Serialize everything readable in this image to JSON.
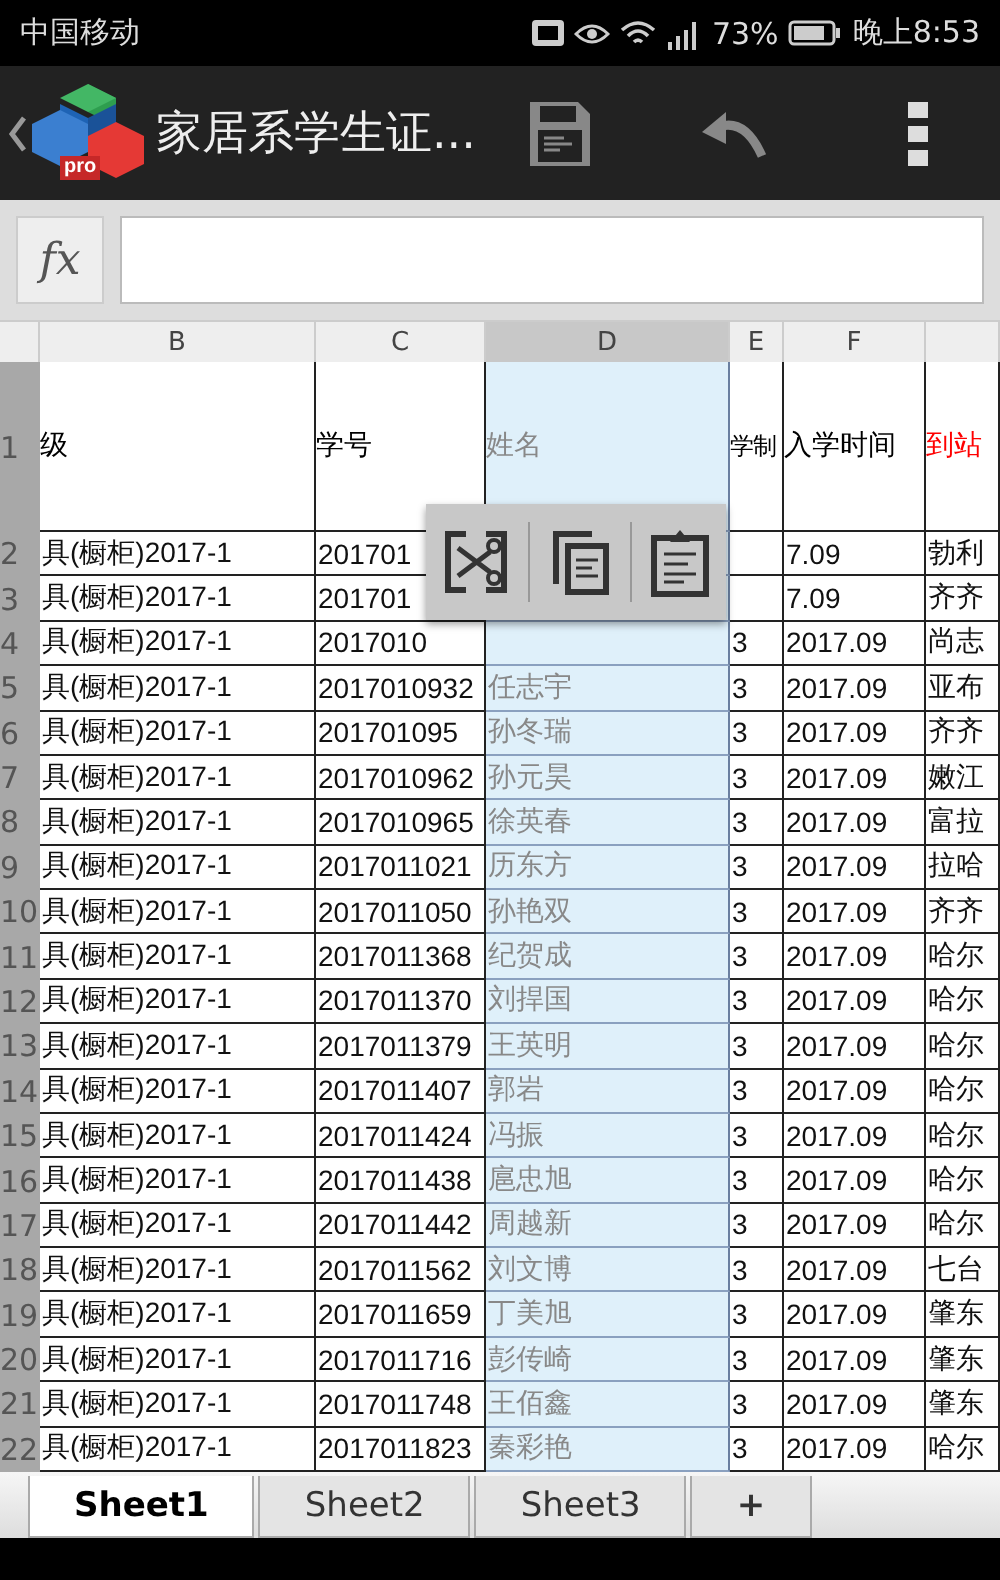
{
  "status_bar": {
    "carrier": "中国移动",
    "battery": "73%",
    "time": "晚上8:53"
  },
  "app_bar": {
    "logo_badge": "pro",
    "title": "家居系学生证..."
  },
  "formula_bar": {
    "label": "fx"
  },
  "sheet": {
    "columns": [
      {
        "label": "B",
        "selected": false
      },
      {
        "label": "C",
        "selected": false
      },
      {
        "label": "D",
        "selected": true
      },
      {
        "label": "E",
        "selected": false
      },
      {
        "label": "F",
        "selected": false
      }
    ],
    "header_row": {
      "number": "1",
      "cells": [
        {
          "text": "级",
          "color": "#000000"
        },
        {
          "text": "学号",
          "color": "#000000"
        },
        {
          "text": "姓名",
          "color": "#888888"
        },
        {
          "text": "学制",
          "color": "#000000"
        },
        {
          "text": "入学时间",
          "color": "#000000"
        },
        {
          "text": "到站",
          "color": "#ff0000"
        }
      ]
    },
    "rows": [
      {
        "number": "2",
        "cells": [
          "具(橱柜)2017-1",
          "201701",
          null,
          null,
          "7.09",
          "勃利"
        ]
      },
      {
        "number": "3",
        "cells": [
          "具(橱柜)2017-1",
          "201701",
          null,
          null,
          "7.09",
          "齐齐"
        ]
      },
      {
        "number": "4",
        "cells": [
          "具(橱柜)2017-1",
          "2017010",
          null,
          "3",
          "2017.09",
          "尚志"
        ]
      },
      {
        "number": "5",
        "cells": [
          "具(橱柜)2017-1",
          "2017010932",
          "任志宇",
          "3",
          "2017.09",
          "亚布"
        ]
      },
      {
        "number": "6",
        "cells": [
          "具(橱柜)2017-1",
          "201701095",
          "孙冬瑞",
          "3",
          "2017.09",
          "齐齐"
        ]
      },
      {
        "number": "7",
        "cells": [
          "具(橱柜)2017-1",
          "2017010962",
          "孙元昊",
          "3",
          "2017.09",
          "嫩江"
        ]
      },
      {
        "number": "8",
        "cells": [
          "具(橱柜)2017-1",
          "2017010965",
          "徐英春",
          "3",
          "2017.09",
          "富拉"
        ]
      },
      {
        "number": "9",
        "cells": [
          "具(橱柜)2017-1",
          "2017011021",
          "历东方",
          "3",
          "2017.09",
          "拉哈"
        ]
      },
      {
        "number": "10",
        "cells": [
          "具(橱柜)2017-1",
          "2017011050",
          "孙艳双",
          "3",
          "2017.09",
          "齐齐"
        ]
      },
      {
        "number": "11",
        "cells": [
          "具(橱柜)2017-1",
          "2017011368",
          "纪贺成",
          "3",
          "2017.09",
          "哈尔"
        ]
      },
      {
        "number": "12",
        "cells": [
          "具(橱柜)2017-1",
          "2017011370",
          "刘捍国",
          "3",
          "2017.09",
          "哈尔"
        ]
      },
      {
        "number": "13",
        "cells": [
          "具(橱柜)2017-1",
          "2017011379",
          "王英明",
          "3",
          "2017.09",
          "哈尔"
        ]
      },
      {
        "number": "14",
        "cells": [
          "具(橱柜)2017-1",
          "2017011407",
          "郭岩",
          "3",
          "2017.09",
          "哈尔"
        ]
      },
      {
        "number": "15",
        "cells": [
          "具(橱柜)2017-1",
          "2017011424",
          "冯振",
          "3",
          "2017.09",
          "哈尔"
        ]
      },
      {
        "number": "16",
        "cells": [
          "具(橱柜)2017-1",
          "2017011438",
          "扈忠旭",
          "3",
          "2017.09",
          "哈尔"
        ]
      },
      {
        "number": "17",
        "cells": [
          "具(橱柜)2017-1",
          "2017011442",
          "周越新",
          "3",
          "2017.09",
          "哈尔"
        ]
      },
      {
        "number": "18",
        "cells": [
          "具(橱柜)2017-1",
          "2017011562",
          "刘文博",
          "3",
          "2017.09",
          "七台"
        ]
      },
      {
        "number": "19",
        "cells": [
          "具(橱柜)2017-1",
          "2017011659",
          "丁美旭",
          "3",
          "2017.09",
          "肇东"
        ]
      },
      {
        "number": "20",
        "cells": [
          "具(橱柜)2017-1",
          "2017011716",
          "彭传崎",
          "3",
          "2017.09",
          "肇东"
        ]
      },
      {
        "number": "21",
        "cells": [
          "具(橱柜)2017-1",
          "2017011748",
          "王佰鑫",
          "3",
          "2017.09",
          "肇东"
        ]
      },
      {
        "number": "22",
        "cells": [
          "具(橱柜)2017-1",
          "2017011823",
          "秦彩艳",
          "3",
          "2017.09",
          "哈尔"
        ]
      }
    ]
  },
  "context_menu": {
    "items": [
      {
        "kind": "cut"
      },
      {
        "kind": "copy"
      },
      {
        "kind": "paste"
      }
    ]
  },
  "sheet_tabs": {
    "tabs": [
      {
        "label": "Sheet1",
        "selected": true
      },
      {
        "label": "Sheet2",
        "selected": false
      },
      {
        "label": "Sheet3",
        "selected": false
      }
    ],
    "add": "+"
  }
}
